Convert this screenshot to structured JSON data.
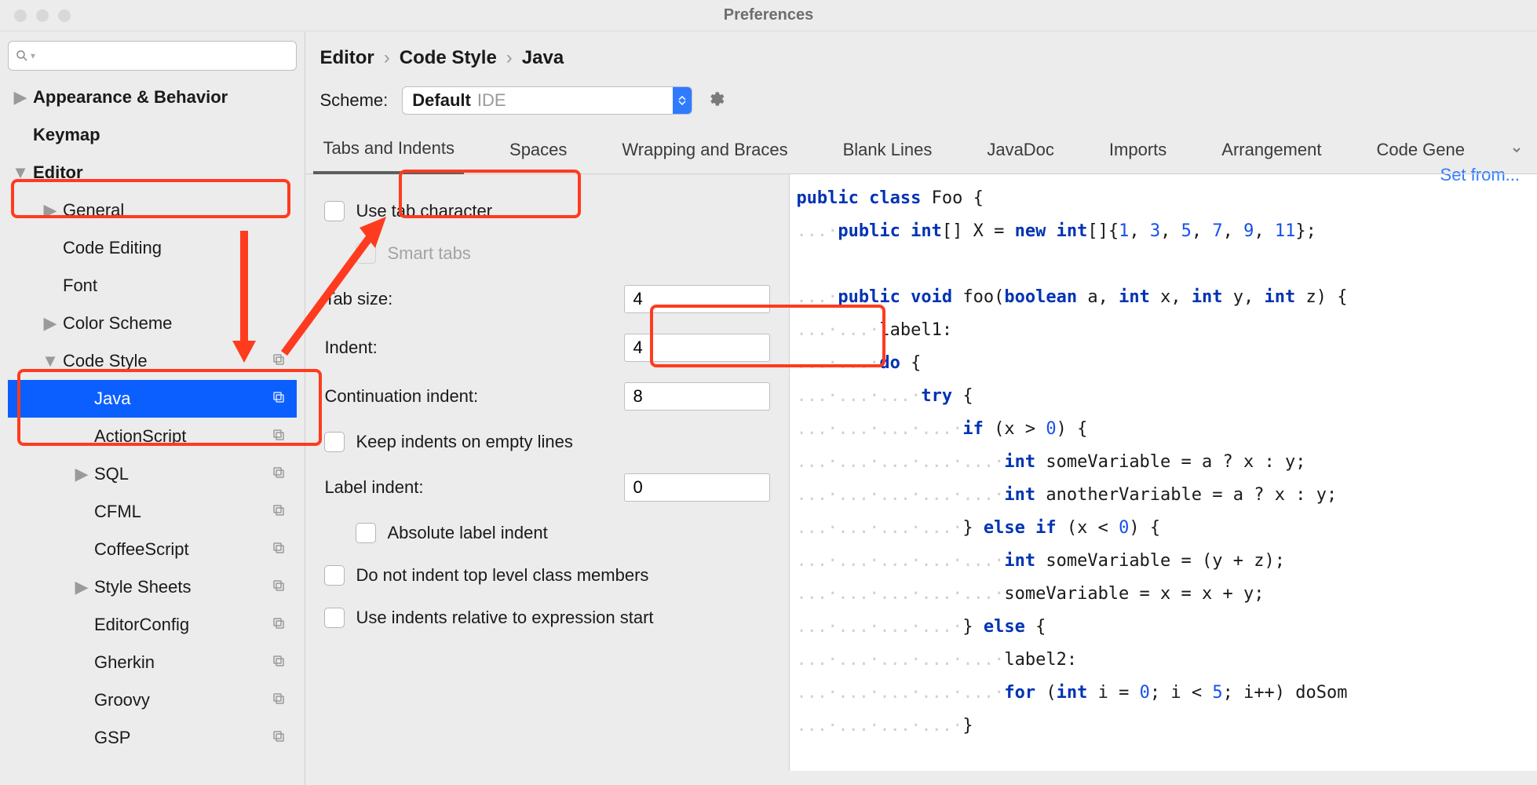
{
  "window": {
    "title": "Preferences"
  },
  "sidebar": {
    "search_placeholder": "",
    "items": [
      {
        "label": "Appearance & Behavior",
        "arrow": "▶",
        "bold": true,
        "indent": 0
      },
      {
        "label": "Keymap",
        "arrow": "",
        "bold": true,
        "indent": 0
      },
      {
        "label": "Editor",
        "arrow": "▼",
        "bold": true,
        "indent": 0
      },
      {
        "label": "General",
        "arrow": "▶",
        "bold": false,
        "indent": 1
      },
      {
        "label": "Code Editing",
        "arrow": "",
        "bold": false,
        "indent": 1
      },
      {
        "label": "Font",
        "arrow": "",
        "bold": false,
        "indent": 1
      },
      {
        "label": "Color Scheme",
        "arrow": "▶",
        "bold": false,
        "indent": 1
      },
      {
        "label": "Code Style",
        "arrow": "▼",
        "bold": false,
        "indent": 1,
        "copy": true
      },
      {
        "label": "Java",
        "arrow": "",
        "bold": false,
        "indent": 2,
        "selected": true,
        "copy": true
      },
      {
        "label": "ActionScript",
        "arrow": "",
        "bold": false,
        "indent": 2,
        "copy": true
      },
      {
        "label": "SQL",
        "arrow": "▶",
        "bold": false,
        "indent": 2,
        "copy": true
      },
      {
        "label": "CFML",
        "arrow": "",
        "bold": false,
        "indent": 2,
        "copy": true
      },
      {
        "label": "CoffeeScript",
        "arrow": "",
        "bold": false,
        "indent": 2,
        "copy": true
      },
      {
        "label": "Style Sheets",
        "arrow": "▶",
        "bold": false,
        "indent": 2,
        "copy": true
      },
      {
        "label": "EditorConfig",
        "arrow": "",
        "bold": false,
        "indent": 2,
        "copy": true
      },
      {
        "label": "Gherkin",
        "arrow": "",
        "bold": false,
        "indent": 2,
        "copy": true
      },
      {
        "label": "Groovy",
        "arrow": "",
        "bold": false,
        "indent": 2,
        "copy": true
      },
      {
        "label": "GSP",
        "arrow": "",
        "bold": false,
        "indent": 2,
        "copy": true
      }
    ]
  },
  "breadcrumb": [
    "Editor",
    "Code Style",
    "Java"
  ],
  "scheme": {
    "label": "Scheme:",
    "name": "Default",
    "scope": "IDE"
  },
  "setfrom": "Set from...",
  "tabs": [
    "Tabs and Indents",
    "Spaces",
    "Wrapping and Braces",
    "Blank Lines",
    "JavaDoc",
    "Imports",
    "Arrangement",
    "Code Gene"
  ],
  "form": {
    "use_tab_char": "Use tab character",
    "smart_tabs": "Smart tabs",
    "tab_size_label": "Tab size:",
    "tab_size_value": "4",
    "indent_label": "Indent:",
    "indent_value": "4",
    "cont_indent_label": "Continuation indent:",
    "cont_indent_value": "8",
    "keep_indents": "Keep indents on empty lines",
    "label_indent_label": "Label indent:",
    "label_indent_value": "0",
    "abs_label_indent": "Absolute label indent",
    "no_indent_top": "Do not indent top level class members",
    "rel_expr": "Use indents relative to expression start"
  },
  "code": {
    "l1a": "public",
    "l1b": "class",
    "l1c": " Foo {",
    "l2a": "public",
    "l2b": "int",
    "l2c": "[] X = ",
    "l2d": "new",
    "l2e": "int",
    "l2f": "[]{",
    "l2n1": "1",
    "l2n2": "3",
    "l2n3": "5",
    "l2n4": "7",
    "l2n5": "9",
    "l2n6": "11",
    "l2g": "};",
    "l4a": "public",
    "l4b": "void",
    "l4c": " foo(",
    "l4d": "boolean",
    "l4e": " a, ",
    "l4f": "int",
    "l4g": " x, ",
    "l4h": "int",
    "l4i": " y, ",
    "l4j": "int",
    "l4k": " z) {",
    "l5": "label1:",
    "l6a": "do",
    "l6b": " {",
    "l7a": "try",
    "l7b": " {",
    "l8a": "if",
    "l8b": " (x > ",
    "l8n": "0",
    "l8c": ") {",
    "l9a": "int",
    "l9b": " someVariable = a ? x : y;",
    "l10a": "int",
    "l10b": " anotherVariable = a ? x : y;",
    "l11a": "} ",
    "l11b": "else",
    "l11c": " ",
    "l11d": "if",
    "l11e": " (x < ",
    "l11n": "0",
    "l11f": ") {",
    "l12a": "int",
    "l12b": " someVariable = (y + z);",
    "l13": "someVariable = x = x + y;",
    "l14a": "} ",
    "l14b": "else",
    "l14c": " {",
    "l15": "label2:",
    "l16a": "for",
    "l16b": " (",
    "l16c": "int",
    "l16d": " i = ",
    "l16n1": "0",
    "l16e": "; i < ",
    "l16n2": "5",
    "l16f": "; i++) doSom",
    "l17": "}"
  }
}
